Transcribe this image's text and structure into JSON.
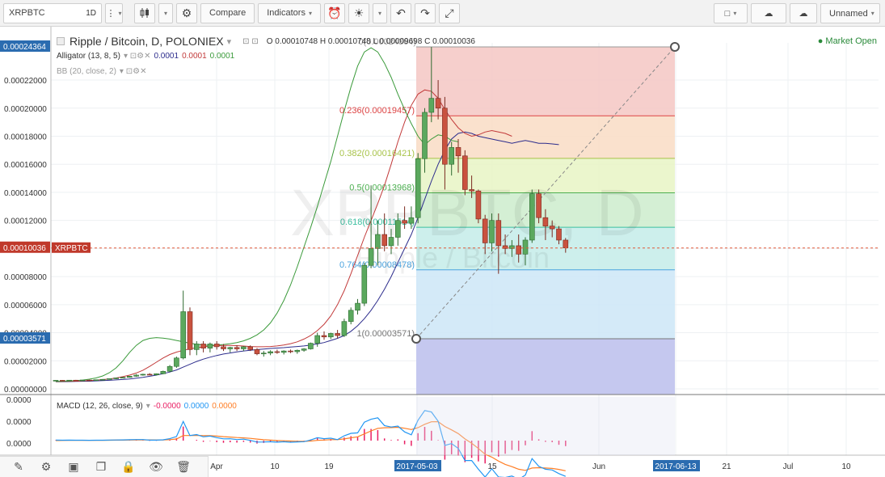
{
  "toolbar": {
    "symbol": "XRPBTC",
    "interval": "1D",
    "compare": "Compare",
    "indicators": "Indicators",
    "layout": "Unnamed"
  },
  "legend": {
    "title": "Ripple / Bitcoin, D, POLONIEX",
    "ohlc": "O 0.00010748  H 0.00010748  L 0.00009698  C 0.00010036",
    "alligator_label": "Alligator (13, 8, 5)",
    "alligator_vals": [
      "0.0001",
      "0.0001",
      "0.0001"
    ],
    "bb_label": "BB (20, close, 2)",
    "macd_label": "MACD (12, 26, close, 9)",
    "macd_vals": [
      "-0.0000",
      "0.0000",
      "0.0000"
    ],
    "market": "Market Open",
    "watermark_big": "XRPBTC, D",
    "watermark_small": "Ripple / Bitcoin"
  },
  "colors": {
    "up": "#5ba85e",
    "down": "#c9523f",
    "jaw": "#2c2c8c",
    "teeth": "#c23a3a",
    "lips": "#3a9a3a",
    "macd": "#2196f3",
    "signal": "#ff7f27",
    "hist": "#e91e63",
    "price_line": "#e05a3a"
  },
  "chart_data": {
    "type": "candlestick",
    "symbol": "XRPBTC",
    "exchange": "POLONIEX",
    "ylim": [
      0.0,
      0.00024364
    ],
    "y_ticks": [
      "0.00000000",
      "0.00002000",
      "0.00004000",
      "0.00006000",
      "0.00008000",
      "0.00010000",
      "0.00012000",
      "0.00014000",
      "0.00016000",
      "0.00018000",
      "0.00020000",
      "0.00022000"
    ],
    "x_labels": [
      "Apr",
      "10",
      "19",
      "2017-05-03",
      "15",
      "Jun",
      "2017-06-13",
      "21",
      "Jul",
      "10"
    ],
    "last_price": "0.00010036",
    "price_tags": [
      "0.00024364",
      "0.00003571"
    ],
    "fib_levels": [
      {
        "ratio": "0",
        "value": "0.00024364"
      },
      {
        "ratio": "0.236",
        "value": "0.00019457"
      },
      {
        "ratio": "0.382",
        "value": "0.00016421"
      },
      {
        "ratio": "0.5",
        "value": "0.00013968"
      },
      {
        "ratio": "0.618",
        "value": "0.00011514"
      },
      {
        "ratio": "0.764",
        "value": "0.00008478"
      },
      {
        "ratio": "1",
        "value": "0.00003571"
      }
    ],
    "candles": [
      [
        6e-06,
        6.2e-06,
        5.8e-06,
        6.1e-06
      ],
      [
        6.1e-06,
        6.3e-06,
        5.9e-06,
        6e-06
      ],
      [
        6e-06,
        6.2e-06,
        5.8e-06,
        6.2e-06
      ],
      [
        6.2e-06,
        6.4e-06,
        6e-06,
        6.1e-06
      ],
      [
        6.1e-06,
        6.3e-06,
        5.9e-06,
        6.3e-06
      ],
      [
        6.3e-06,
        6.5e-06,
        6e-06,
        6.2e-06
      ],
      [
        6.2e-06,
        6.6e-06,
        6.1e-06,
        6.5e-06
      ],
      [
        6.5e-06,
        7e-06,
        6.3e-06,
        6.8e-06
      ],
      [
        6.8e-06,
        7.5e-06,
        6.6e-06,
        7.3e-06
      ],
      [
        7.3e-06,
        8e-06,
        7e-06,
        7.8e-06
      ],
      [
        7.8e-06,
        8.5e-06,
        7.5e-06,
        8.2e-06
      ],
      [
        8.2e-06,
        9.2e-06,
        8e-06,
        9e-06
      ],
      [
        9e-06,
        1.05e-05,
        8.6e-06,
        9.8e-06
      ],
      [
        9.8e-06,
        1.08e-05,
        9.4e-06,
        1.04e-05
      ],
      [
        1.04e-05,
        1.12e-05,
        9.8e-06,
        1e-05
      ],
      [
        1e-05,
        1.1e-05,
        9.6e-06,
        1.08e-05
      ],
      [
        1.08e-05,
        1.3e-05,
        1.04e-05,
        1.25e-05
      ],
      [
        1.25e-05,
        1.7e-05,
        1.2e-05,
        1.6e-05
      ],
      [
        1.6e-05,
        2.3e-05,
        1.5e-05,
        2.2e-05
      ],
      [
        2.2e-05,
        7e-05,
        2.1e-05,
        5.5e-05
      ],
      [
        5.5e-05,
        5.8e-05,
        2.4e-05,
        2.8e-05
      ],
      [
        2.8e-05,
        3.4e-05,
        2.4e-05,
        3.2e-05
      ],
      [
        3.2e-05,
        3.4e-05,
        2.6e-05,
        2.9e-05
      ],
      [
        2.9e-05,
        3.3e-05,
        2.6e-05,
        3.2e-05
      ],
      [
        3.2e-05,
        3.4e-05,
        2.8e-05,
        3e-05
      ],
      [
        3e-05,
        3.2e-05,
        2.7e-05,
        2.85e-05
      ],
      [
        2.85e-05,
        3e-05,
        2.6e-05,
        2.95e-05
      ],
      [
        2.95e-05,
        3.1e-05,
        2.7e-05,
        2.85e-05
      ],
      [
        2.85e-05,
        3.05e-05,
        2.7e-05,
        3e-05
      ],
      [
        3e-05,
        3.1e-05,
        2.7e-05,
        2.8e-05
      ],
      [
        2.8e-05,
        2.9e-05,
        2.4e-05,
        2.5e-05
      ],
      [
        2.5e-05,
        2.7e-05,
        2.3e-05,
        2.55e-05
      ],
      [
        2.55e-05,
        2.75e-05,
        2.4e-05,
        2.65e-05
      ],
      [
        2.65e-05,
        2.8e-05,
        2.5e-05,
        2.6e-05
      ],
      [
        2.6e-05,
        2.75e-05,
        2.45e-05,
        2.7e-05
      ],
      [
        2.7e-05,
        2.8e-05,
        2.55e-05,
        2.65e-05
      ],
      [
        2.65e-05,
        2.8e-05,
        2.5e-05,
        2.75e-05
      ],
      [
        2.75e-05,
        2.9e-05,
        2.65e-05,
        2.85e-05
      ],
      [
        2.85e-05,
        3.3e-05,
        2.8e-05,
        3.25e-05
      ],
      [
        3.25e-05,
        4e-05,
        3e-05,
        3.8e-05
      ],
      [
        3.8e-05,
        4.1e-05,
        3.5e-05,
        3.7e-05
      ],
      [
        3.7e-05,
        4e-05,
        3.55e-05,
        3.95e-05
      ],
      [
        3.95e-05,
        4.2e-05,
        3.6e-05,
        3.8e-05
      ],
      [
        3.8e-05,
        5e-05,
        3.7e-05,
        4.8e-05
      ],
      [
        4.8e-05,
        5.8e-05,
        4.6e-05,
        5.6e-05
      ],
      [
        5.6e-05,
        6.4e-05,
        5.3e-05,
        6.1e-05
      ],
      [
        6.1e-05,
        9e-05,
        5.9e-05,
        8.8e-05
      ],
      [
        8.8e-05,
        0.000145,
        8.6e-05,
        0.0001
      ],
      [
        0.0001,
        0.00012,
        8.8e-05,
        0.00011
      ],
      [
        0.00011,
        0.000125,
        9.8e-05,
        0.000102
      ],
      [
        0.000102,
        0.000114,
        9.6e-05,
        0.000108
      ],
      [
        0.000108,
        0.000125,
        0.000102,
        0.00012
      ],
      [
        0.00012,
        0.00013,
        0.000114,
        0.000118
      ],
      [
        0.000118,
        0.00013,
        0.000114,
        0.000122
      ],
      [
        0.000122,
        0.000168,
        0.000118,
        0.000164
      ],
      [
        0.000164,
        0.0002,
        0.000154,
        0.000197
      ],
      [
        0.000197,
        0.0002436,
        0.00019,
        0.000207
      ],
      [
        0.000207,
        0.00022,
        0.000192,
        0.0002
      ],
      [
        0.0002,
        0.000208,
        0.000142,
        0.00016
      ],
      [
        0.00016,
        0.000176,
        0.000152,
        0.000172
      ],
      [
        0.000172,
        0.000178,
        0.000154,
        0.000166
      ],
      [
        0.000166,
        0.00017,
        0.000138,
        0.000142
      ],
      [
        0.000142,
        0.000152,
        0.000136,
        0.000141
      ],
      [
        0.000141,
        0.000142,
        0.000118,
        0.000121
      ],
      [
        0.000121,
        0.000124,
        9.6e-05,
        0.000104
      ],
      [
        0.000104,
        0.000125,
        9.8e-05,
        0.00012
      ],
      [
        0.00012,
        0.000125,
        8.2e-05,
        0.000102
      ],
      [
        0.000102,
        0.00011,
        9.6e-05,
        0.0001
      ],
      [
        0.0001,
        0.000106,
        9.4e-05,
        0.000102
      ],
      [
        0.000102,
        0.00011,
        9e-05,
        9.6e-05
      ],
      [
        9.6e-05,
        0.000108,
        8.8e-05,
        0.000106
      ],
      [
        0.000106,
        0.000142,
        0.000104,
        0.000139
      ],
      [
        0.000139,
        0.000142,
        0.000118,
        0.000122
      ],
      [
        0.000122,
        0.000128,
        0.000106,
        0.000116
      ],
      [
        0.000116,
        0.00012,
        0.000108,
        0.000114
      ],
      [
        0.000114,
        0.000116,
        0.000103,
        0.000106
      ],
      [
        0.000106,
        0.0001075,
        9.7e-05,
        0.0001004
      ]
    ],
    "jaw": [
      5e-06,
      5.1e-06,
      5.2e-06,
      5.3e-06,
      5.4e-06,
      5.5e-06,
      5.7e-06,
      5.9e-06,
      6.1e-06,
      6.4e-06,
      6.7e-06,
      7.1e-06,
      7.6e-06,
      8.2e-06,
      9e-06,
      9.8e-06,
      1.08e-05,
      1.2e-05,
      1.35e-05,
      1.55e-05,
      1.75e-05,
      1.95e-05,
      2.12e-05,
      2.26e-05,
      2.38e-05,
      2.48e-05,
      2.56e-05,
      2.63e-05,
      2.7e-05,
      2.75e-05,
      2.8e-05,
      2.84e-05,
      2.88e-05,
      2.91e-05,
      2.94e-05,
      2.98e-05,
      3.02e-05,
      3.06e-05,
      3.12e-05,
      3.2e-05,
      3.3e-05,
      3.45e-05,
      3.6e-05,
      3.8e-05,
      4.1e-05,
      4.5e-05,
      5e-05,
      5.6e-05,
      6.3e-05,
      7.1e-05,
      8e-05,
      9e-05,
      0.0001,
      0.00011,
      0.000122,
      0.000135,
      0.000148,
      0.00016,
      0.00017,
      0.000178,
      0.000182,
      0.000183,
      0.000182,
      0.00018,
      0.000179,
      0.000178,
      0.000177,
      0.000176,
      0.000175,
      0.000176,
      0.000177,
      0.000176,
      0.000175,
      0.000175,
      0.0001745,
      0.000174
    ],
    "teeth": [
      5.2e-06,
      5.3e-06,
      5.4e-06,
      5.5e-06,
      5.7e-06,
      5.9e-06,
      6.2e-06,
      6.6e-06,
      7.1e-06,
      7.8e-06,
      8.7e-06,
      9.8e-06,
      1.13e-05,
      1.33e-05,
      1.6e-05,
      1.9e-05,
      2.2e-05,
      2.45e-05,
      2.62e-05,
      2.75e-05,
      2.85e-05,
      2.93e-05,
      3e-05,
      3.05e-05,
      3.08e-05,
      3.1e-05,
      3.1e-05,
      3.08e-05,
      3.05e-05,
      3.02e-05,
      3e-05,
      3e-05,
      3.02e-05,
      3.06e-05,
      3.12e-05,
      3.22e-05,
      3.35e-05,
      3.55e-05,
      3.8e-05,
      4.15e-05,
      4.6e-05,
      5.2e-05,
      6e-05,
      7e-05,
      8.2e-05,
      9.5e-05,
      0.000108,
      0.00012,
      0.000132,
      0.000145,
      0.00016,
      0.000176,
      0.00019,
      0.000202,
      0.00021,
      0.000213,
      0.000212,
      0.000207,
      0.000199,
      0.000192,
      0.000186,
      0.000182,
      0.00018,
      0.000181,
      0.000183,
      0.000184,
      0.000183,
      0.000182,
      0.00018
    ],
    "lips": [
      5.3e-06,
      5.4e-06,
      5.6e-06,
      5.9e-06,
      6.3e-06,
      6.9e-06,
      7.8e-06,
      9.2e-06,
      1.15e-05,
      1.5e-05,
      2e-05,
      2.6e-05,
      3.1e-05,
      3.45e-05,
      3.6e-05,
      3.65e-05,
      3.62e-05,
      3.55e-05,
      3.45e-05,
      3.35e-05,
      3.25e-05,
      3.18e-05,
      3.12e-05,
      3.1e-05,
      3.12e-05,
      3.16e-05,
      3.22e-05,
      3.3e-05,
      3.42e-05,
      3.6e-05,
      3.85e-05,
      4.2e-05,
      4.7e-05,
      5.4e-05,
      6.3e-05,
      7.4e-05,
      8.7e-05,
      0.000101,
      0.000115,
      0.00013,
      0.000146,
      0.000162,
      0.00018,
      0.000198,
      0.000215,
      0.00023,
      0.00024,
      0.000243,
      0.00024,
      0.000232,
      0.000222,
      0.00021,
      0.000199,
      0.000189,
      0.00018,
      0.000174,
      0.000178,
      0.000181,
      0.00018,
      0.000177,
      0.000176
    ]
  }
}
